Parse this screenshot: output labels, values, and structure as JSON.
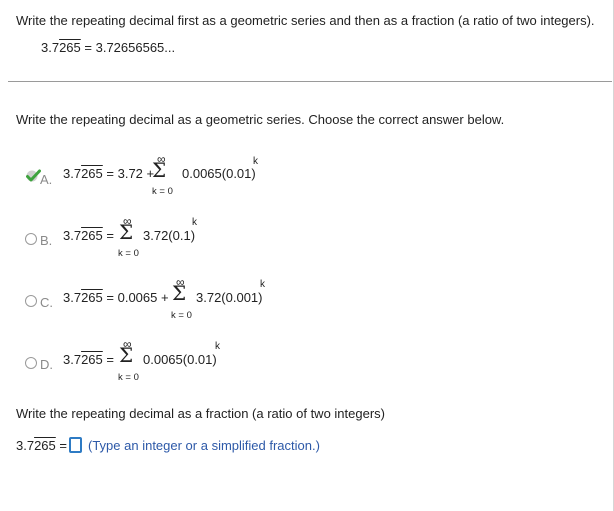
{
  "problem": {
    "instruction": "Write the repeating decimal first as a geometric series and then as a fraction (a ratio of two integers).",
    "given_decimal": {
      "lead": "3.7",
      "repeat": "265",
      "tail": " = 3.72656565..."
    }
  },
  "part1": {
    "prompt": "Write the repeating decimal as a geometric series. Choose the correct answer below.",
    "options": [
      {
        "letter": "A.",
        "lhs_lead": "3.7",
        "lhs_repeat": "265",
        "middle": " = 3.72 + ",
        "term": "0.0065(0.01)",
        "selected": true
      },
      {
        "letter": "B.",
        "lhs_lead": "3.7",
        "lhs_repeat": "265",
        "middle": " = ",
        "term": "3.72(0.1)",
        "selected": false
      },
      {
        "letter": "C.",
        "lhs_lead": "3.7",
        "lhs_repeat": "265",
        "middle": " = 0.0065 + ",
        "term": "3.72(0.001)",
        "selected": false
      },
      {
        "letter": "D.",
        "lhs_lead": "3.7",
        "lhs_repeat": "265",
        "middle": " = ",
        "term": "0.0065(0.01)",
        "selected": false
      }
    ],
    "sum_upper": "∞",
    "sum_symbol": "Σ",
    "sum_lower": "k = 0",
    "exponent": "k"
  },
  "part2": {
    "prompt": "Write the repeating decimal as a fraction (a ratio of two integers)",
    "lhs_lead": "3.7",
    "lhs_repeat": "265",
    "equals": " =",
    "hint": "(Type an integer or a simplified fraction.)",
    "answer_value": ""
  },
  "colors": {
    "correct_check": "#3ea33e",
    "hint_text": "#2d59a8",
    "input_border": "#2e7bc4"
  }
}
